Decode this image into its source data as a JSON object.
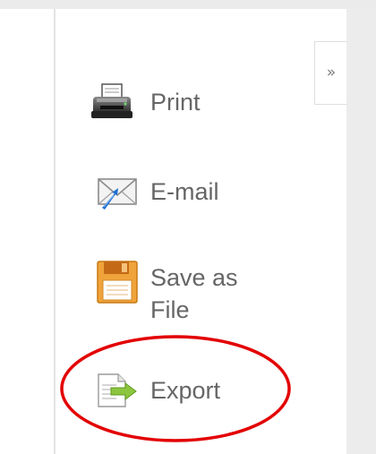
{
  "collapse_toggle": {
    "glyph": "»",
    "icon": "double-chevron-right-icon"
  },
  "menu": {
    "items": [
      {
        "label": "Print",
        "icon": "printer-icon"
      },
      {
        "label": "E-mail",
        "icon": "email-envelope-icon"
      },
      {
        "label": "Save as File",
        "icon": "floppy-disk-icon"
      },
      {
        "label": "Export",
        "icon": "export-document-icon"
      }
    ]
  },
  "annotation": {
    "shape": "ellipse",
    "color": "#e30000",
    "target": "Export"
  },
  "colors": {
    "label_text": "#666666",
    "right_panel": "#ececec",
    "top_strip": "#ebebeb"
  }
}
